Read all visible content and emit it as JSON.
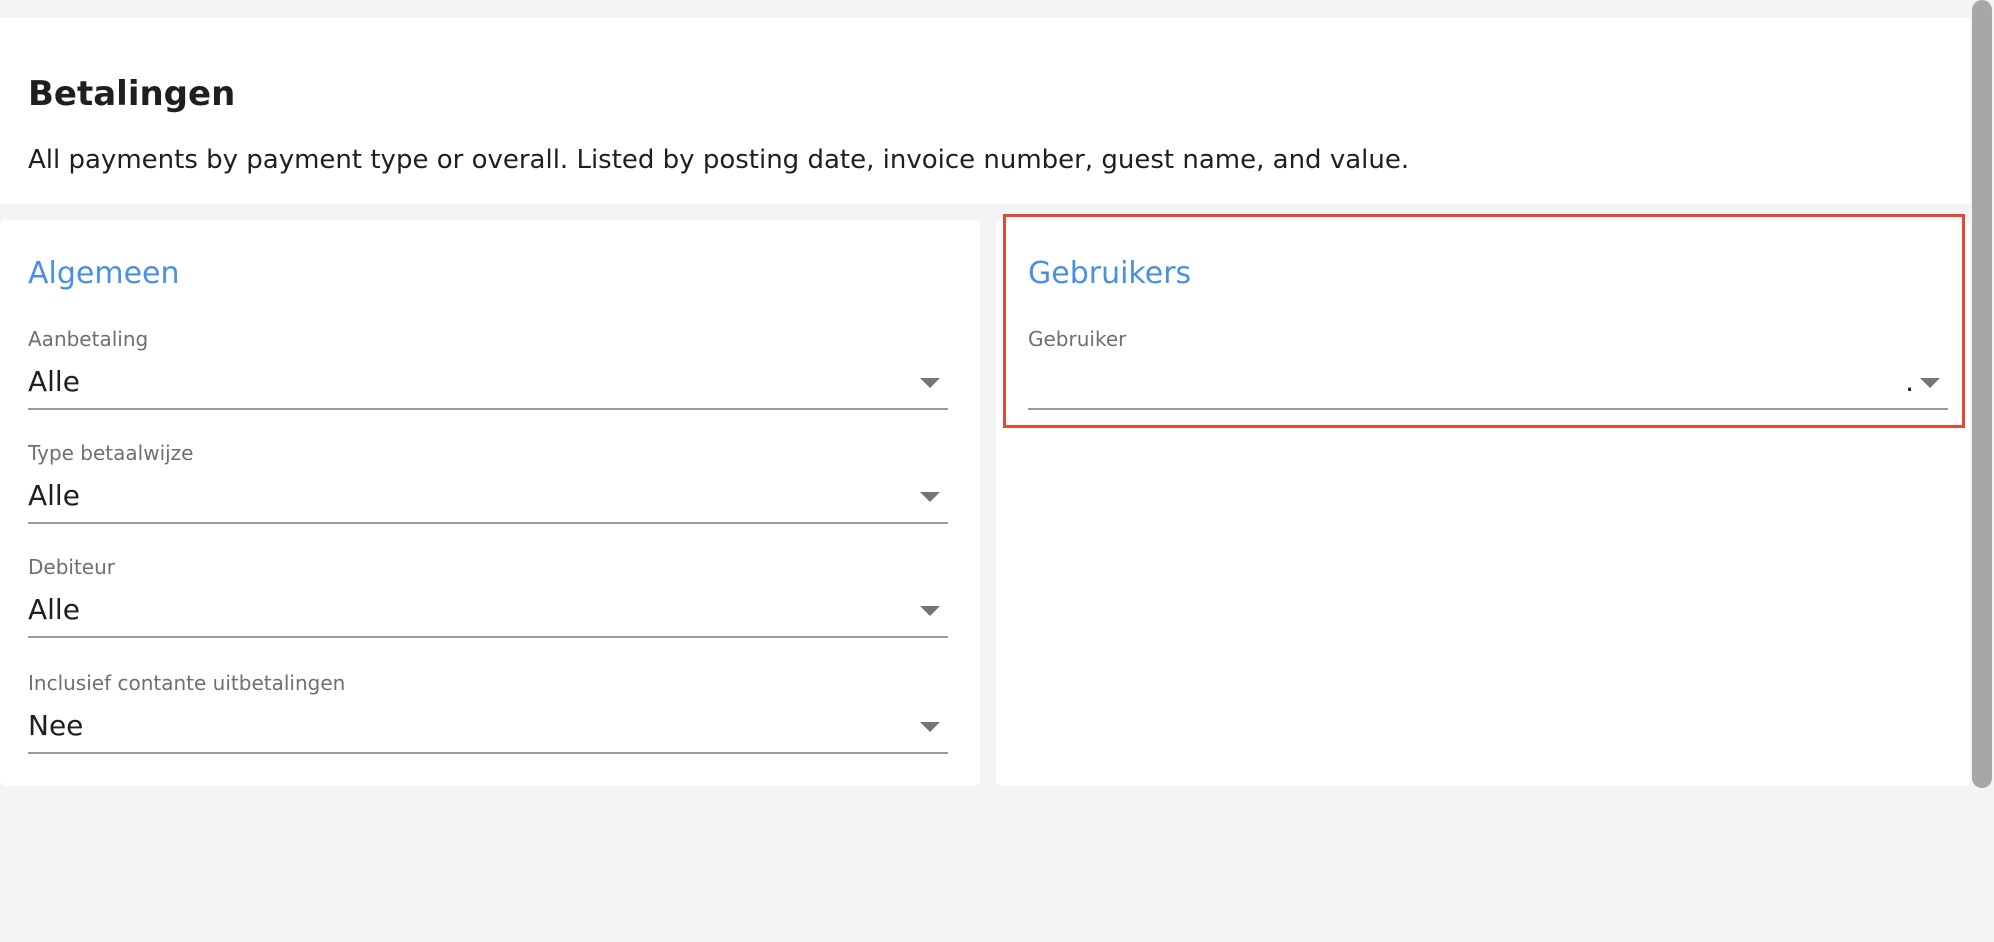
{
  "page": {
    "title": "Betalingen",
    "description": "All payments by payment type or overall. Listed by posting date, invoice number, guest name, and value."
  },
  "general": {
    "title": "Algemeen",
    "fields": [
      {
        "label": "Aanbetaling",
        "value": "Alle"
      },
      {
        "label": "Type betaalwijze",
        "value": "Alle"
      },
      {
        "label": "Debiteur",
        "value": "Alle"
      },
      {
        "label": "Inclusief contante uitbetalingen",
        "value": "Nee"
      }
    ]
  },
  "users": {
    "title": "Gebruikers",
    "field": {
      "label": "Gebruiker",
      "value": "",
      "marker": "."
    }
  },
  "colors": {
    "accent": "#4a90e2",
    "highlight": "#e34a33",
    "underline": "#9b9b9b"
  },
  "icons": {
    "dropdown": "triangle-down"
  }
}
